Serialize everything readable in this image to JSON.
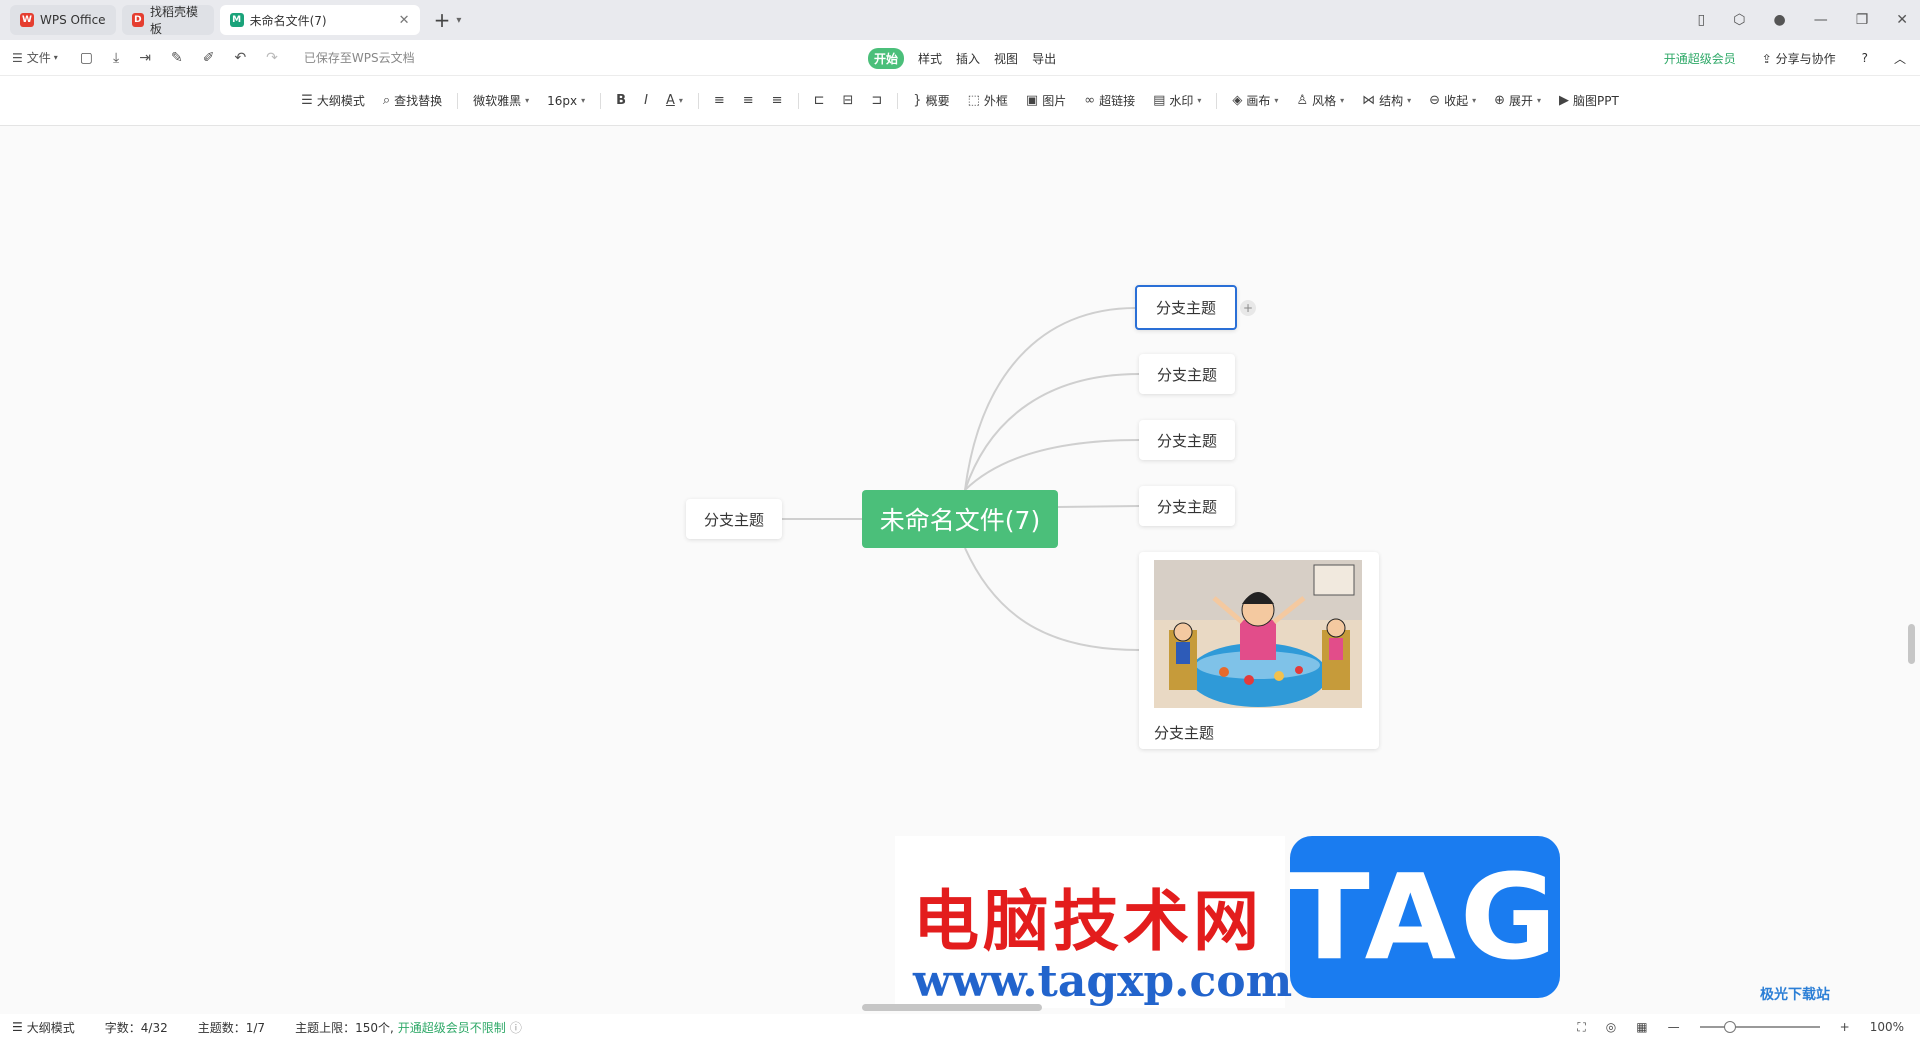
{
  "tabs": [
    {
      "label": "WPS Office",
      "icon": "wps-logo-icon",
      "color": "#e53e30"
    },
    {
      "label": "找稻壳模板",
      "icon": "docer-icon",
      "color": "#e53e30"
    },
    {
      "label": "未命名文件(7)",
      "icon": "mindmap-file-icon",
      "color": "#1aa37a",
      "active": true
    }
  ],
  "menubar": {
    "file_label": "文件",
    "saved_status": "已保存至WPS云文档",
    "tabs": [
      "开始",
      "样式",
      "插入",
      "视图",
      "导出"
    ],
    "active_tab": "开始",
    "vip_label": "开通超级会员",
    "share_label": "分享与协作",
    "help_icon": "?"
  },
  "toolbar": {
    "outline_mode": "大纲模式",
    "find_replace": "查找替换",
    "font_family": "微软雅黑",
    "font_size": "16px",
    "bold": "B",
    "italic": "I",
    "font_color": "A",
    "summary": "概要",
    "frame": "外框",
    "image": "图片",
    "hyperlink": "超链接",
    "watermark": "水印",
    "canvas": "画布",
    "style": "风格",
    "structure": "结构",
    "collapse": "收起",
    "expand": "展开",
    "to_ppt": "脑图PPT"
  },
  "mindmap": {
    "root": "未命名文件(7)",
    "left_branch": "分支主题",
    "right_branches": [
      "分支主题",
      "分支主题",
      "分支主题",
      "分支主题"
    ],
    "image_branch_caption": "分支主题",
    "accent": "#4bbf7a",
    "selected_border": "#2a6fd6"
  },
  "watermark": {
    "cn_text": "电脑技术网",
    "url": "www.tagxp.com",
    "tag": "TAG",
    "corner_site": "极光下载站"
  },
  "statusbar": {
    "outline_mode": "大纲模式",
    "word_count": "字数：4/32",
    "topic_count": "主题数：1/7",
    "topic_limit": "主题上限：150个,",
    "topic_limit_link": "开通超级会员不限制",
    "zoom": "100%"
  }
}
